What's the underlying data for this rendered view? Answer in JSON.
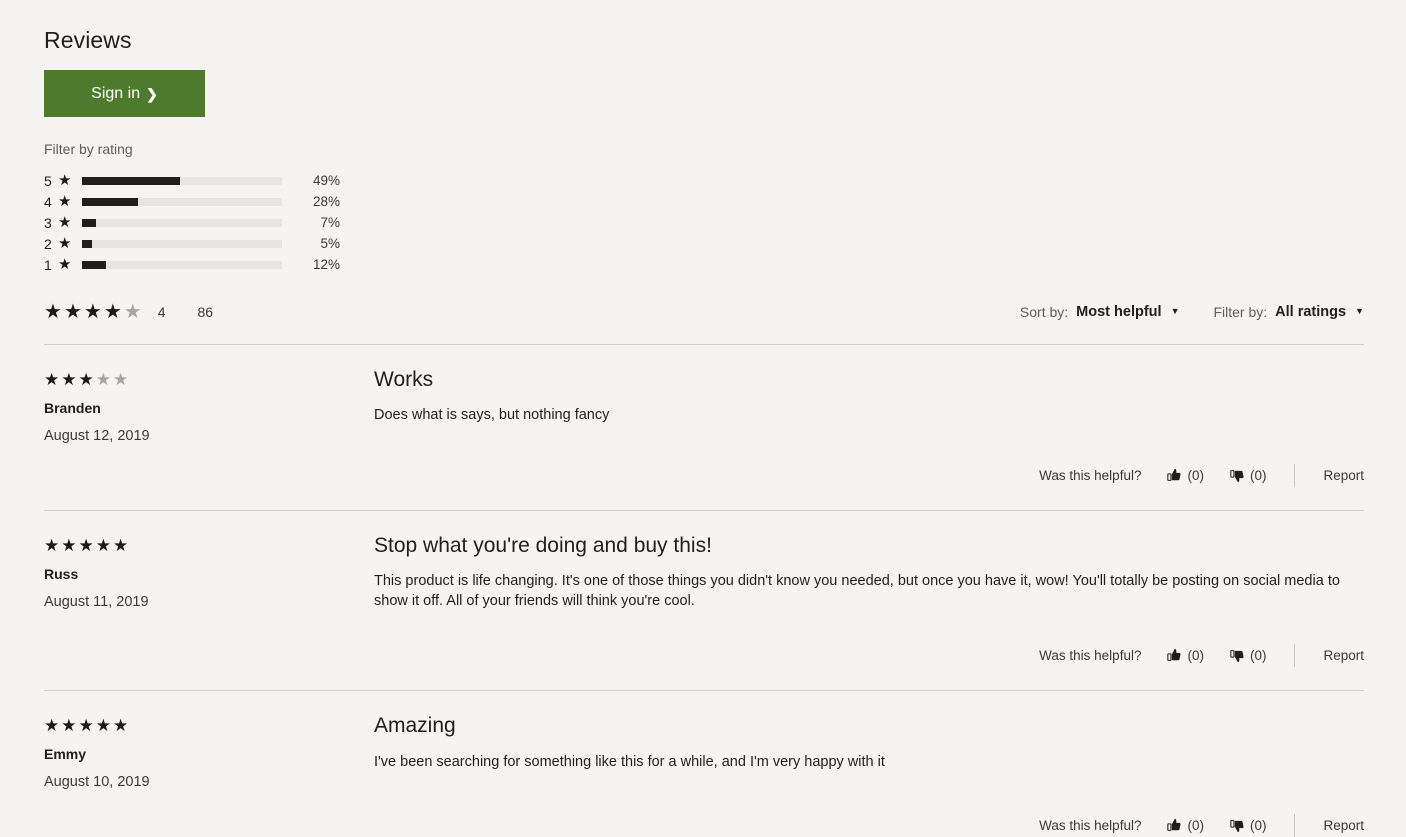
{
  "header": {
    "title": "Reviews",
    "sign_in_label": "Sign in",
    "sign_in_chevron": "chevron-right-icon"
  },
  "rating_filter": {
    "label": "Filter by rating",
    "rows": [
      {
        "stars": "5",
        "percent": "49%",
        "percent_value": 49
      },
      {
        "stars": "4",
        "percent": "28%",
        "percent_value": 28
      },
      {
        "stars": "3",
        "percent": "7%",
        "percent_value": 7
      },
      {
        "stars": "2",
        "percent": "5%",
        "percent_value": 5
      },
      {
        "stars": "1",
        "percent": "12%",
        "percent_value": 12
      }
    ],
    "star_glyph": "★"
  },
  "summary": {
    "filled_stars": 4,
    "total_stars": 5,
    "average": "4",
    "review_count": "86"
  },
  "controls": {
    "sort_label": "Sort by:",
    "sort_value": "Most helpful",
    "filter_label": "Filter by:",
    "filter_value": "All ratings",
    "caret_icon": "chevron-down-icon"
  },
  "helpful": {
    "prompt": "Was this helpful?",
    "thumbs_up_icon": "thumbs-up-icon",
    "thumbs_down_icon": "thumbs-down-icon",
    "report_label": "Report"
  },
  "reviews": [
    {
      "rating": 3,
      "author": "Branden",
      "date": "August 12, 2019",
      "title": "Works",
      "text": "Does what is says, but nothing fancy",
      "helpful_yes": "(0)",
      "helpful_no": "(0)"
    },
    {
      "rating": 5,
      "author": "Russ",
      "date": "August 11, 2019",
      "title": "Stop what you're doing and buy this!",
      "text": "This product is life changing. It's one of those things you didn't know you needed, but once you have it, wow! You'll totally be posting on social media to show it off. All of your friends will think you're cool.",
      "helpful_yes": "(0)",
      "helpful_no": "(0)"
    },
    {
      "rating": 5,
      "author": "Emmy",
      "date": "August 10, 2019",
      "title": "Amazing",
      "text": "I've been searching for something like this for a while, and I'm very happy with it",
      "helpful_yes": "(0)",
      "helpful_no": "(0)"
    }
  ],
  "colors": {
    "page_background": "#f5f4f2",
    "accent_green": "#4d7a2d",
    "star_filled": "#1b1a19",
    "star_empty": "#a8a6a4",
    "bar_fill": "#201f1e",
    "bar_track": "#e6e5e4",
    "divider": "#d2d0ce"
  }
}
